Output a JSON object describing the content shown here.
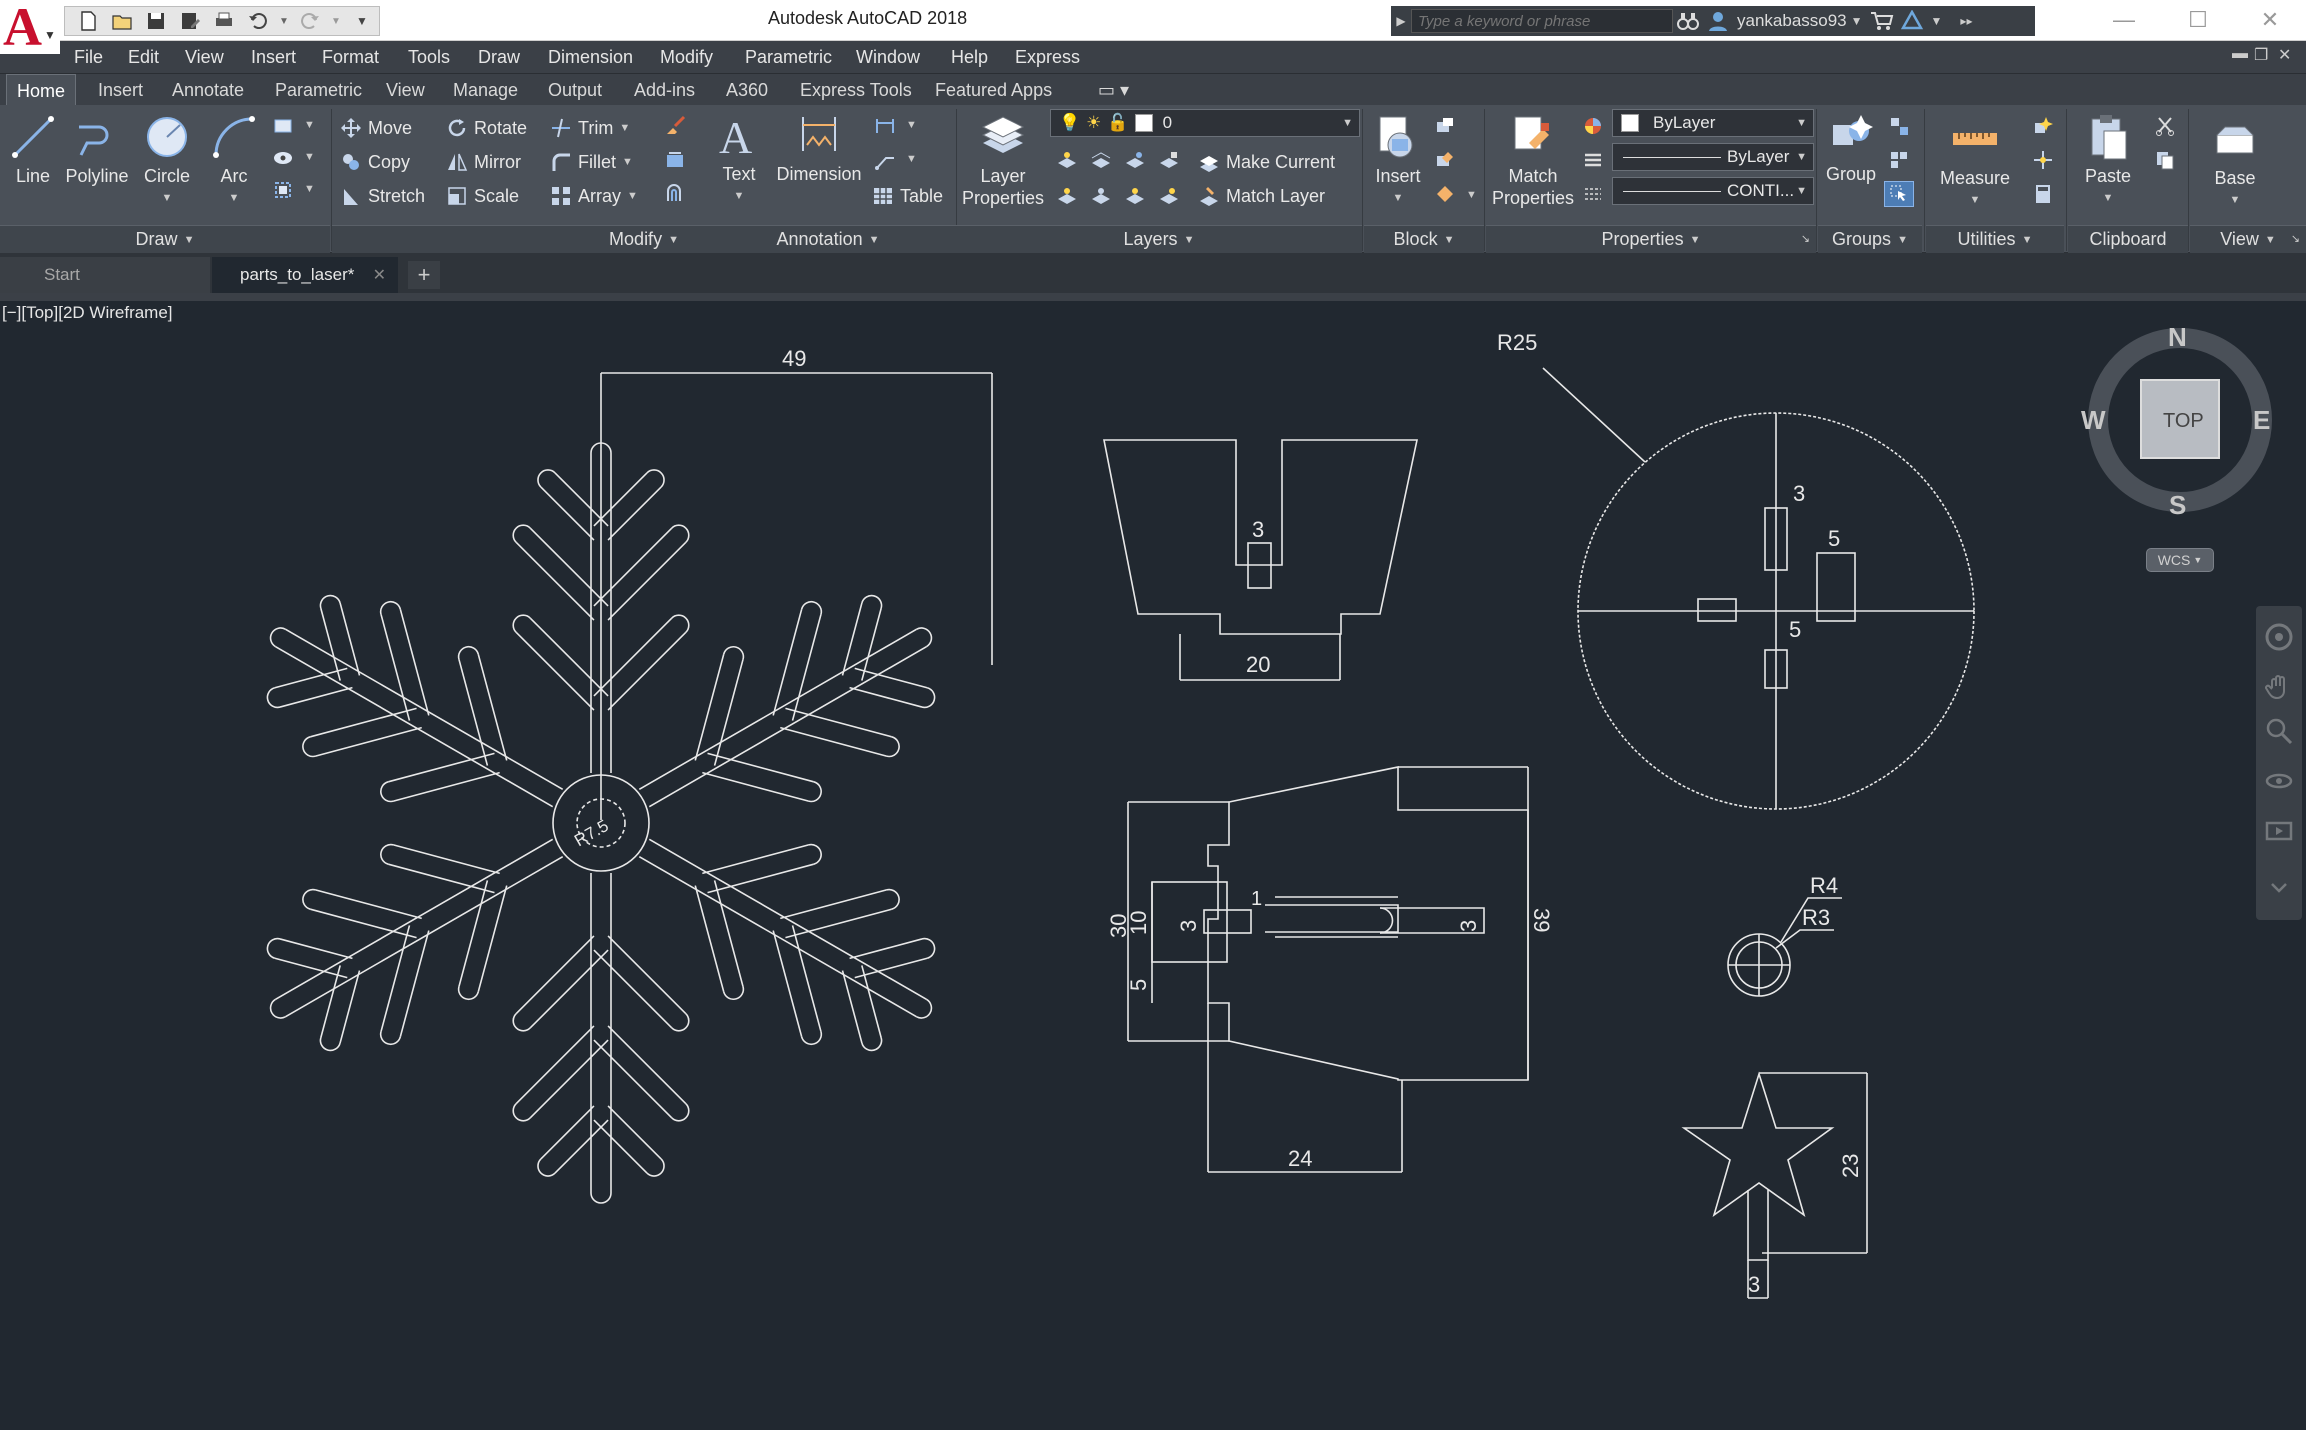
{
  "app": {
    "title": "Autodesk AutoCAD 2018",
    "logo_letter": "A",
    "search_placeholder": "Type a keyword or phrase",
    "user_name": "yankabasso93"
  },
  "menu": [
    "File",
    "Edit",
    "View",
    "Insert",
    "Format",
    "Tools",
    "Draw",
    "Dimension",
    "Modify",
    "Parametric",
    "Window",
    "Help",
    "Express"
  ],
  "ribbon_tabs": [
    "Home",
    "Insert",
    "Annotate",
    "Parametric",
    "View",
    "Manage",
    "Output",
    "Add-ins",
    "A360",
    "Express Tools",
    "Featured Apps"
  ],
  "ribbon": {
    "draw": {
      "title": "Draw",
      "line": "Line",
      "polyline": "Polyline",
      "circle": "Circle",
      "arc": "Arc"
    },
    "modify": {
      "title": "Modify",
      "move": "Move",
      "rotate": "Rotate",
      "trim": "Trim",
      "copy": "Copy",
      "mirror": "Mirror",
      "fillet": "Fillet",
      "stretch": "Stretch",
      "scale": "Scale",
      "array": "Array"
    },
    "annotation": {
      "title": "Annotation",
      "text": "Text",
      "dimension": "Dimension",
      "table": "Table"
    },
    "layers": {
      "title": "Layers",
      "layer_props_1": "Layer",
      "layer_props_2": "Properties",
      "current_layer": "0",
      "make_current": "Make Current",
      "match_layer": "Match Layer"
    },
    "block": {
      "title": "Block",
      "insert": "Insert"
    },
    "properties": {
      "title": "Properties",
      "match_1": "Match",
      "match_2": "Properties",
      "color": "ByLayer",
      "lineweight": "ByLayer",
      "linetype": "CONTI..."
    },
    "groups": {
      "title": "Groups",
      "group": "Group"
    },
    "utilities": {
      "title": "Utilities",
      "measure": "Measure"
    },
    "clipboard": {
      "title": "Clipboard",
      "paste": "Paste"
    },
    "view": {
      "title": "View",
      "base": "Base"
    }
  },
  "file_tabs": [
    {
      "label": "Start"
    },
    {
      "label": "parts_to_laser*"
    }
  ],
  "viewport": {
    "label": "[−][Top][2D Wireframe]"
  },
  "viewcube": {
    "north": "N",
    "south": "S",
    "east": "E",
    "west": "W",
    "face": "TOP",
    "wcs": "WCS"
  },
  "dimensions": {
    "snow_width": "49",
    "snow_radius": "R7.5",
    "trap_slot": "3",
    "trap_base": "20",
    "circle_r": "R25",
    "circle_slot_top": "3",
    "circle_slot_right": "5",
    "circle_slot_lower": "5",
    "side_h30": "30",
    "side_h10": "10",
    "side_h5": "5",
    "side_slot_left": "3",
    "side_slot_right": "3",
    "side_small": "1",
    "side_h39": "39",
    "side_base": "24",
    "ring_outer": "R4",
    "ring_inner": "R3",
    "star_h": "23",
    "star_stem": "3"
  },
  "colors": {
    "canvas": "#212830",
    "line": "#e8e8e8",
    "ribbon": "#4a5058",
    "accent_red": "#c8102e"
  }
}
